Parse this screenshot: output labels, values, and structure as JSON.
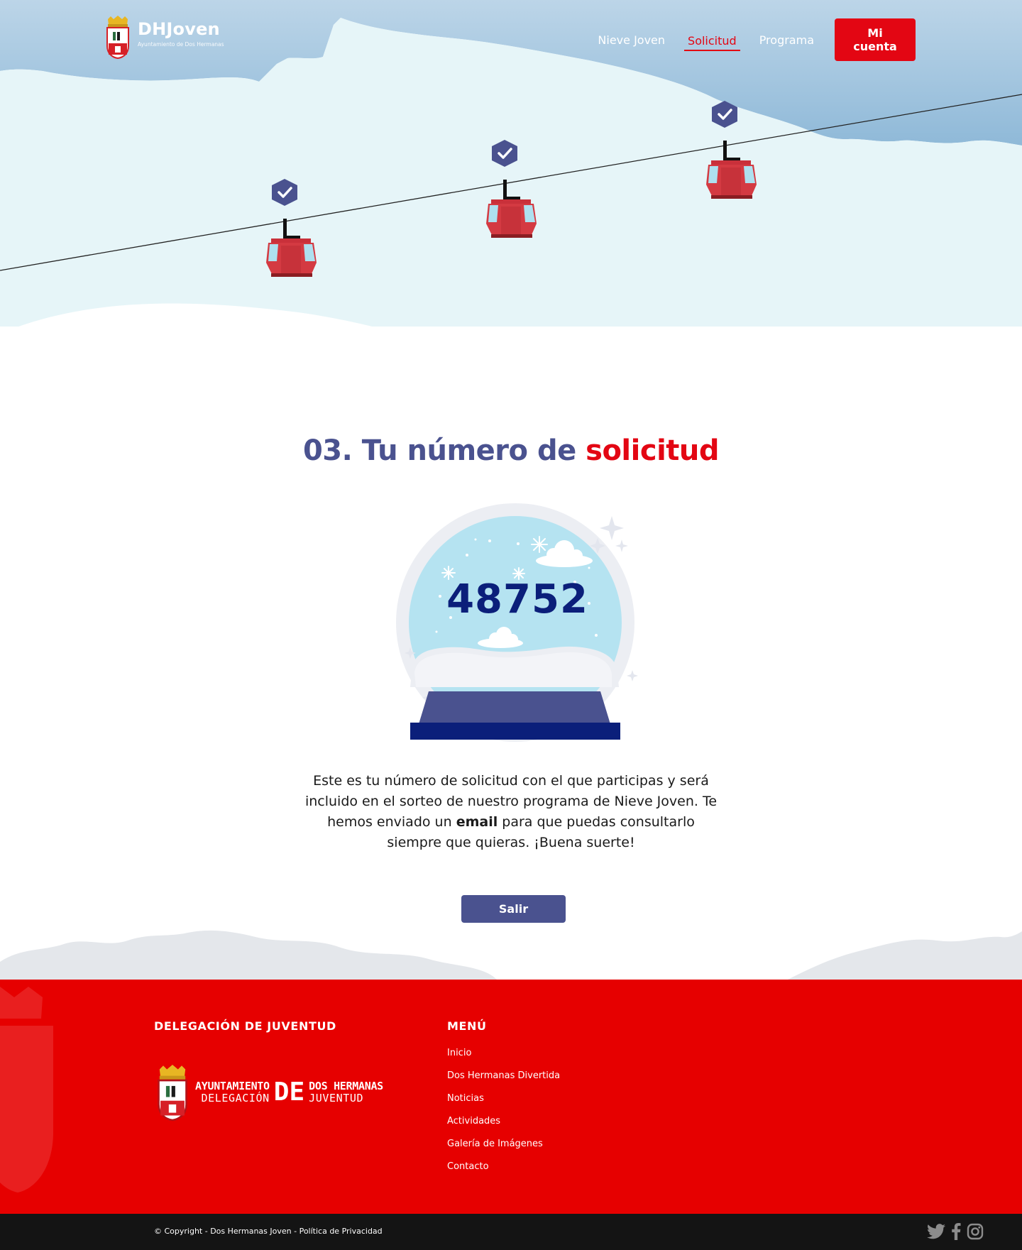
{
  "header": {
    "logo_title": "DHJoven",
    "logo_subtitle": "Ayuntamiento de Dos Hermanas",
    "nav": [
      {
        "label": "Nieve Joven",
        "active": false
      },
      {
        "label": "Solicitud",
        "active": true
      },
      {
        "label": "Programa",
        "active": false
      }
    ],
    "account_button": "Mi cuenta"
  },
  "steps": {
    "completed": 3,
    "total": 3,
    "icon": "check-icon"
  },
  "main": {
    "title_prefix": "03. Tu número de ",
    "title_accent": "solicitud",
    "request_number": "48752",
    "description_part1": "Este es tu número de solicitud con el que participas y será incluido en el sorteo de nuestro programa de Nieve Joven. Te hemos enviado un ",
    "description_bold": "email",
    "description_part2": " para que puedas consultarlo siempre que quieras. ¡Buena suerte!",
    "exit_button": "Salir"
  },
  "footer": {
    "col1_title": "DELEGACIÓN DE JUVENTUD",
    "org_logo": {
      "left_line1": "AYUNTAMIENTO",
      "left_line2": "DELEGACIÓN",
      "middle": "DE",
      "right_line1": "DOS HERMANAS",
      "right_line2": "JUVENTUD"
    },
    "col2_title": "MENÚ",
    "menu": [
      "Inicio",
      "Dos Hermanas Divertida",
      "Noticias",
      "Actividades",
      "Galería de Imágenes",
      "Contacto"
    ],
    "copyright": "© Copyright - Dos Hermanas Joven - Política de Privacidad",
    "social": [
      "twitter-icon",
      "facebook-icon",
      "instagram-icon"
    ]
  },
  "colors": {
    "brand_red": "#e30613",
    "footer_red": "#e60000",
    "navy": "#4a528f",
    "dark_navy": "#0b1f7a",
    "sky_blue": "#a9c9e1",
    "ice": "#e6f5f8",
    "globe_water": "#b5e3f1"
  }
}
